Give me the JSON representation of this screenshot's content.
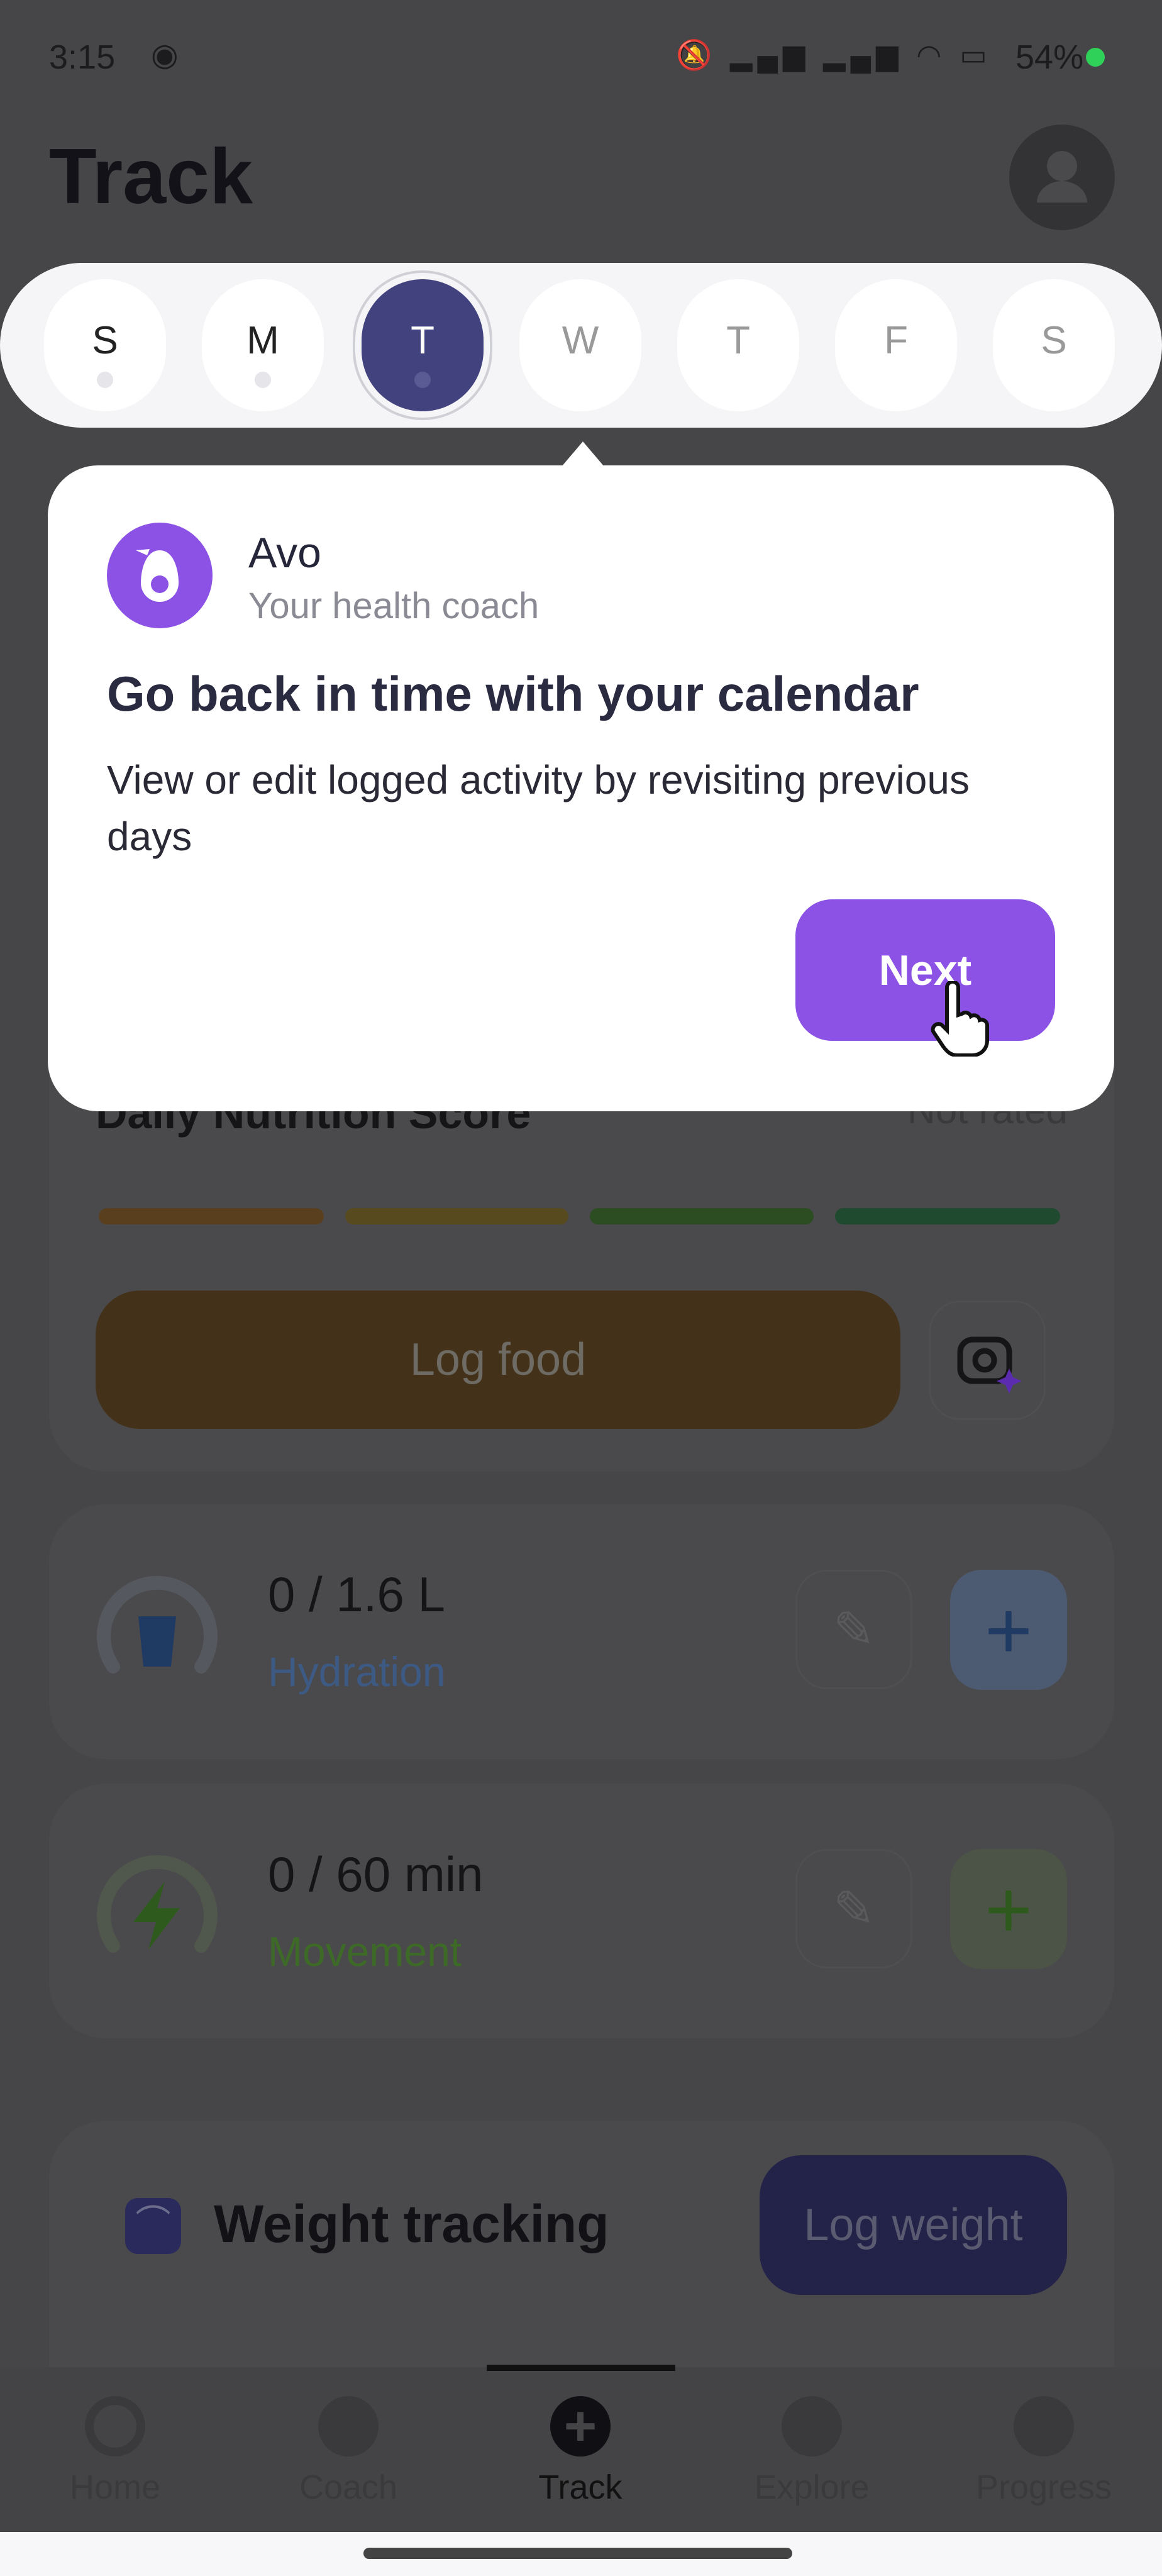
{
  "status_bar": {
    "time": "3:15",
    "battery": "54%"
  },
  "header": {
    "title": "Track"
  },
  "week": {
    "days": [
      "S",
      "M",
      "T",
      "W",
      "T",
      "F",
      "S"
    ],
    "selected_index": 2
  },
  "coach_popup": {
    "name": "Avo",
    "subtitle": "Your health coach",
    "heading": "Go back in time with your calendar",
    "body": "View or edit logged activity by revisiting previous days",
    "next_label": "Next"
  },
  "nutrition": {
    "title": "Daily Nutrition Score",
    "rating": "Not rated",
    "log_food_label": "Log food",
    "score_colors": [
      "#5a3f1e",
      "#574a1e",
      "#2c4d22",
      "#1f4a2f"
    ]
  },
  "hydration": {
    "value": "0 / 1.6 L",
    "label": "Hydration",
    "progress": 0,
    "color": "#3d5a85"
  },
  "movement": {
    "value": "0 / 60 min",
    "label": "Movement",
    "progress": 0,
    "color": "#3e6a28"
  },
  "weight": {
    "title": "Weight tracking",
    "button_label": "Log weight"
  },
  "nav": {
    "items": [
      "Home",
      "Coach",
      "Track",
      "Explore",
      "Progress"
    ],
    "active": "Track"
  },
  "colors": {
    "accent": "#8c52e6",
    "selected_day": "#42427e"
  }
}
